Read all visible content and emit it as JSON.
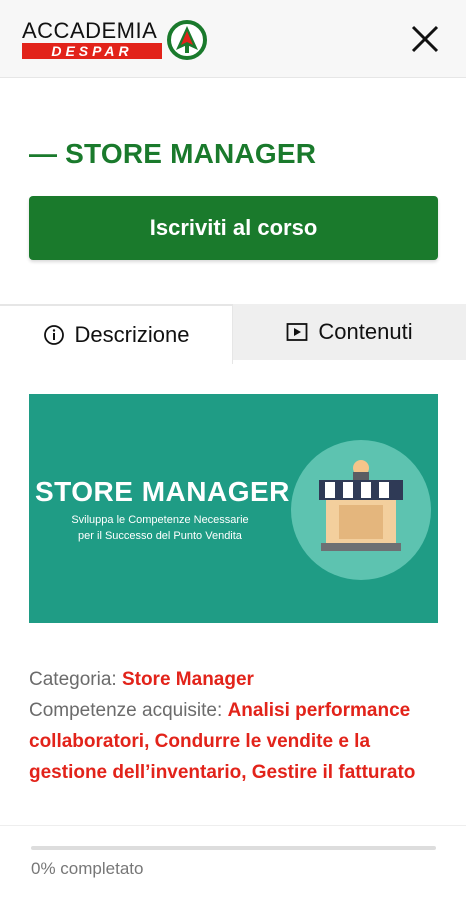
{
  "header": {
    "logo_top": "ACCADEMIA",
    "logo_bottom": "DESPAR",
    "close_icon": "close-icon"
  },
  "course": {
    "title": "— STORE MANAGER",
    "enroll_label": "Iscriviti al corso"
  },
  "tabs": [
    {
      "label": "Descrizione",
      "icon": "info-icon",
      "active": true
    },
    {
      "label": "Contenuti",
      "icon": "play-icon",
      "active": false
    }
  ],
  "banner": {
    "title": "STORE MANAGER",
    "subtitle_line1": "Sviluppa le Competenze Necessarie",
    "subtitle_line2": "per il Successo del Punto Vendita",
    "background": "#1f9c85"
  },
  "info": {
    "category_label": "Categoria: ",
    "category_value": "Store Manager",
    "skills_label": "Competenze acquisite: ",
    "skills_value": "Analisi performance collaboratori, Condurre le vendite e la gestione dell’inventario, Gestire il fatturato"
  },
  "progress": {
    "percent": 0,
    "text": "0% completato"
  },
  "colors": {
    "brand_green": "#1a7a2c",
    "accent_red": "#e2231a"
  }
}
